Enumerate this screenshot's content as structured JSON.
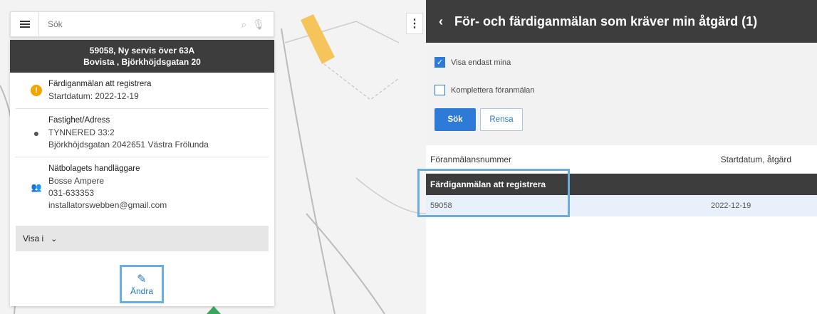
{
  "map": {
    "toggle_label": "⋮"
  },
  "search": {
    "placeholder": "Sök"
  },
  "card": {
    "header_line1": "59058, Ny servis över 63A",
    "header_line2": "Bovista , Björkhöjdsgatan 20",
    "status": {
      "label": "Färdiganmälan att registrera",
      "value": "Startdatum: 2022-12-19"
    },
    "property": {
      "label": "Fastighet/Adress",
      "line1": "TYNNERED 33:2",
      "line2": "Björkhöjdsgatan 2042651 Västra Frölunda"
    },
    "handler": {
      "label": "Nätbolagets handläggare",
      "name": "Bosse Ampere",
      "phone": "031-633353",
      "email": "installatorswebben@gmail.com"
    },
    "show_in_label": "Visa i",
    "edit_label": "Ändra"
  },
  "panel": {
    "title": "För- och färdiganmälan som kräver min åtgärd (1)",
    "filter_only_mine": "Visa endast mina",
    "filter_complete": "Komplettera föranmälan",
    "search_button": "Sök",
    "clear_button": "Rensa",
    "columns": [
      "Föranmälansnummer",
      "Startdatum, åtgärd"
    ],
    "group_label": "Färdiganmälan att registrera",
    "rows": [
      {
        "number": "59058",
        "date": "2022-12-19"
      }
    ]
  }
}
